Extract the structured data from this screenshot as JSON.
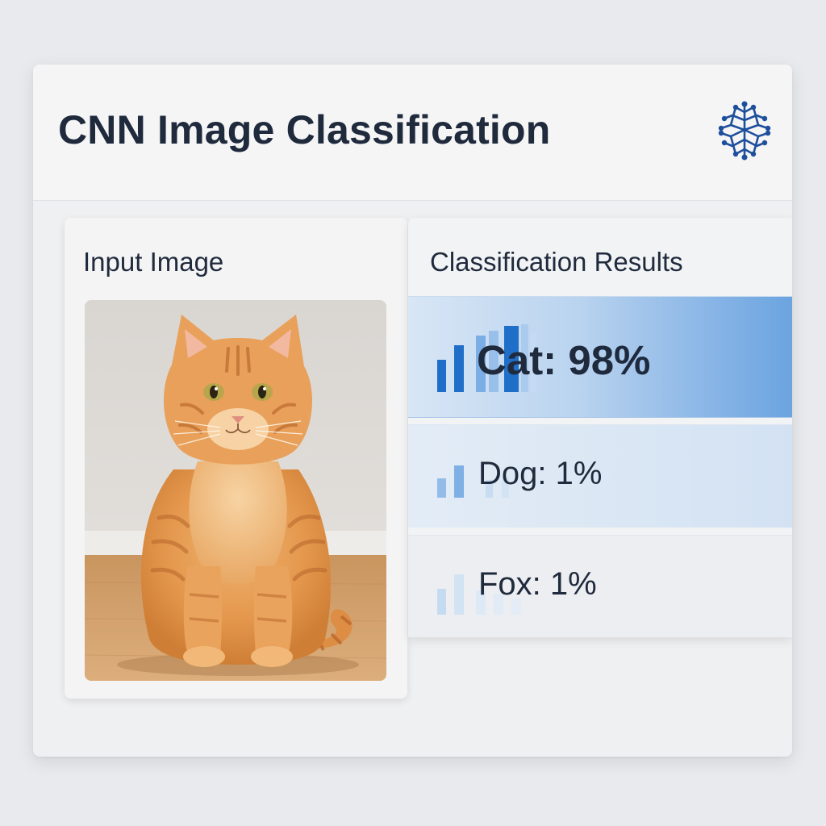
{
  "header": {
    "title": "CNN Image Classification",
    "icon": "neural-network-icon",
    "icon_color": "#1d4f9c"
  },
  "input_panel": {
    "title": "Input Image",
    "image": "orange-tabby-cat-photo"
  },
  "results_panel": {
    "title": "Classification Results",
    "results": [
      {
        "label": "Cat: 98%",
        "class": "Cat",
        "confidence": 0.98,
        "icon": "bar-chart-icon"
      },
      {
        "label": "Dog: 1%",
        "class": "Dog",
        "confidence": 0.01,
        "icon": "bar-chart-icon"
      },
      {
        "label": "Fox: 1%",
        "class": "Fox",
        "confidence": 0.01,
        "icon": "bar-chart-icon"
      }
    ]
  },
  "colors": {
    "accent": "#1f6fc8",
    "text": "#1f2a3c",
    "highlight": "#6ba4e0"
  }
}
